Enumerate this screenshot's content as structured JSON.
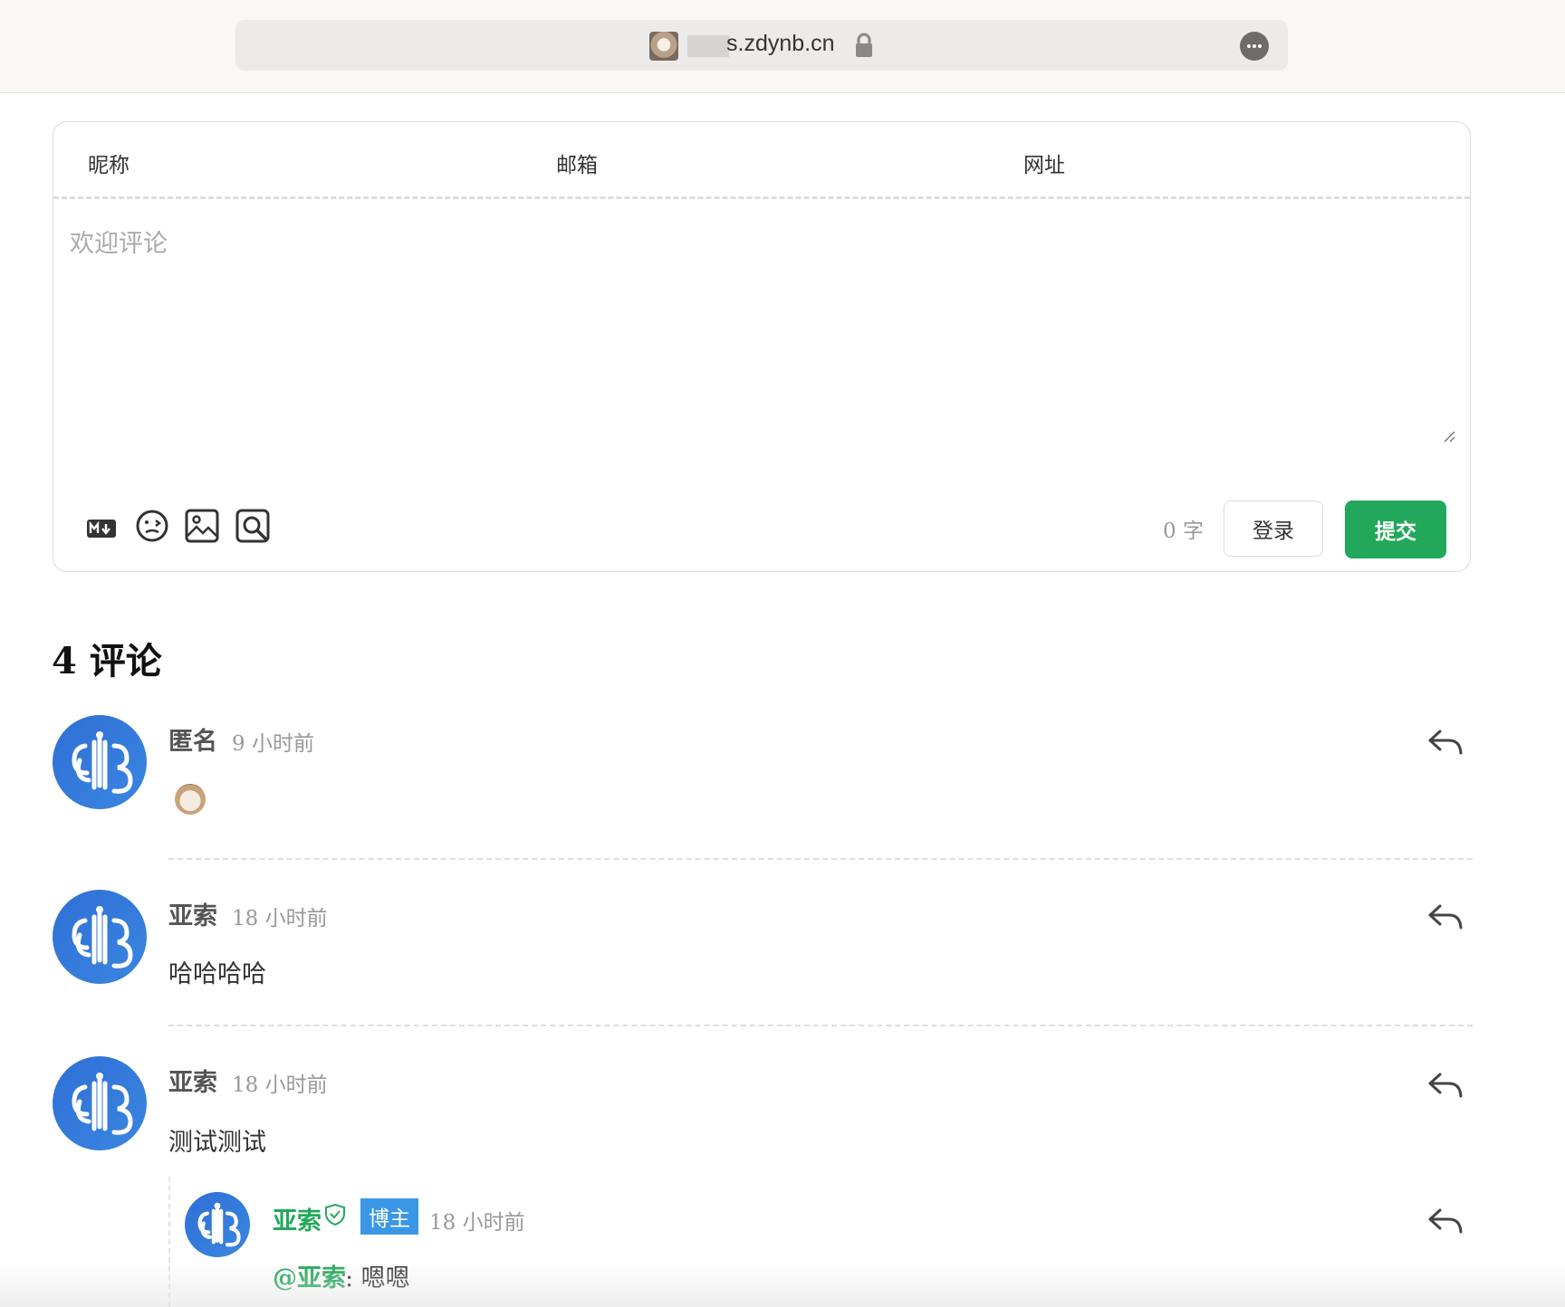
{
  "browser": {
    "url": "s.zdynb.cn",
    "icons": [
      "site-favicon",
      "lock-icon",
      "more-icon"
    ]
  },
  "form": {
    "nickname_label": "昵称",
    "email_label": "邮箱",
    "website_label": "网址",
    "textarea_placeholder": "欢迎评论",
    "tools": [
      "markdown-icon",
      "emoji-icon",
      "image-icon",
      "preview-icon"
    ],
    "char_count": "0 字",
    "login_label": "登录",
    "submit_label": "提交"
  },
  "comments_header": "4 评论",
  "comments": [
    {
      "author": "匿名",
      "time": "9 小时前",
      "body": "",
      "emoji": "cat-emoji"
    },
    {
      "author": "亚索",
      "time": "18 小时前",
      "body": "哈哈哈哈"
    },
    {
      "author": "亚索",
      "time": "18 小时前",
      "body": "测试测试"
    }
  ],
  "reply": {
    "author": "亚索",
    "badge": "博主",
    "time": "18 小时前",
    "mention": "@亚索",
    "body": ": 嗯嗯"
  },
  "colors": {
    "accent": "#22a85a",
    "badge": "#3a97e6",
    "avatar": "#2f6fd6"
  }
}
